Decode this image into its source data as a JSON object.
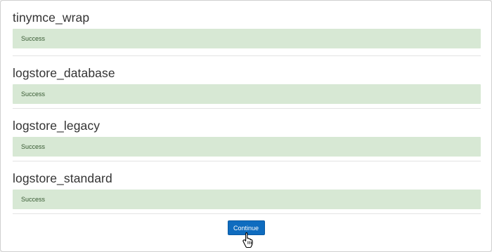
{
  "upgrade_results": [
    {
      "plugin": "tinymce_wrap",
      "status": "Success"
    },
    {
      "plugin": "logstore_database",
      "status": "Success"
    },
    {
      "plugin": "logstore_legacy",
      "status": "Success"
    },
    {
      "plugin": "logstore_standard",
      "status": "Success"
    }
  ],
  "actions": {
    "continue_label": "Continue"
  },
  "colors": {
    "success_background": "#d7e8d4",
    "success_text": "#375a32",
    "primary_button": "#0f6cbf"
  },
  "icons": {
    "pointer": "hand-pointer-cursor-icon"
  }
}
